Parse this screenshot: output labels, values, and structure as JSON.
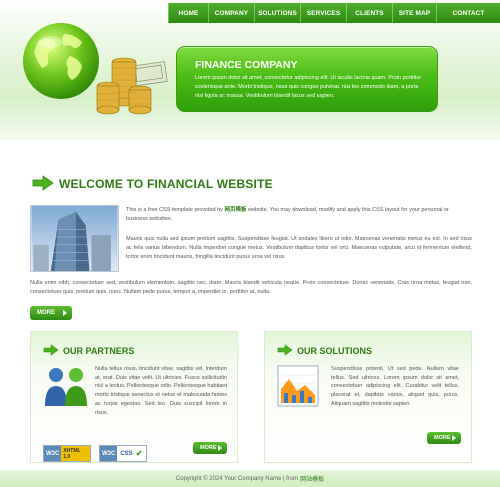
{
  "nav": {
    "items": [
      "HOME",
      "COMPANY",
      "SOLUTIONS",
      "SERVICES",
      "CLIENTS",
      "SITE MAP",
      "CONTACT"
    ]
  },
  "banner": {
    "title": "FINANCE COMPANY",
    "text": "Lorem ipsum dolor sit amet, consectetur adipiscing elit. Ut iaculis lacinia quam. Proin porttitor scelerisque ante. Morbi tristique, risus quis congue pulvinar, nisi leo commodo diam, a porta nisi ligula ac massa. Vestibulum blandit lacus sed sapien."
  },
  "welcome": {
    "title": "WELCOME TO FINANCIAL WEBSITE",
    "para1_before": "This is a free CSS template provided by ",
    "para1_link": "网页模板",
    "para1_after": " website. You may download, modify and apply this CSS layout for your personal or business websites.",
    "para2": "Mauris quis nulla sed ipsum pretium sagittis. Suspendisse feugiat. Ut sodales libero ut odio. Maecenas venenatis metus eu est. In sed risus ac felis varius bibendum. Nulla imperdiet congue metus. Vestibulum dapibus tortor vel orci. Maecenas vulputate, arcu id fermentum eleifend, tortor enim tincidunt mauris, fringilla tincidunt purus urna vel risus.",
    "para3": "Nulla enim nibh, consectetuer sed, vestibulum elementum, sagittis nec, diam. Mauris blandit vehicula neque. Proin consectetuer. Donec venenatis. Cras urna metus, feugiat non, consectetuer quis, pretium quis, nunc. Nullam pede purus, tempor a, imperdiet in, porttitor at, nulla.",
    "more_label": "MORE"
  },
  "partners": {
    "title": "OUR PARTNERS",
    "text": "Nulla tellus risus, tincidunt vitae, sagittis vel, interdum at, erat. Duis vitae velit. Ut ultricies. Fusce sollicitudin nisl a lectus. Pellentesque odio. Pellentesque habitant morbi tristique senectus et netus et malesuada fames ac turpis egestas. Sed leo. Duis suscipit lorem in risus.",
    "more_label": "MORE",
    "badge_xhtml": "XHTML 1.0",
    "badge_css": "CSS"
  },
  "solutions": {
    "title": "OUR SOLUTIONS",
    "text": "Suspendisse potenti. Ut sed pede. Nullam vitae tellus. Sed ultrices. Lorem ipsum dolor sit amet, consectetuer adipiscing elit. Curabitur velit tellus, placerat et, dapibus varius, aliquet quis, purus. Aliquam sagittis molestie sapien.",
    "more_label": "MORE"
  },
  "footer": {
    "text": "Copyright © 2024 Your Company Name | from",
    "link": "网站模板"
  }
}
